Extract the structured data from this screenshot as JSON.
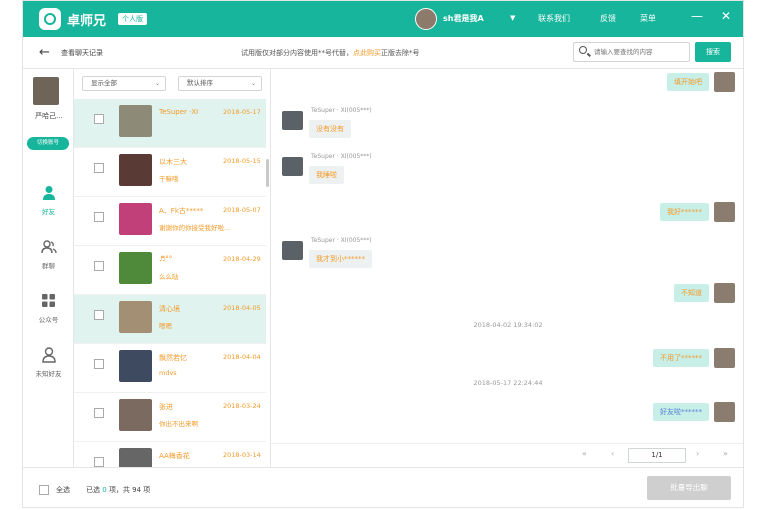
{
  "titlebar": {
    "app_name": "卓师兄",
    "edition": "个人版",
    "username": "sh君是我A",
    "links": [
      "联系我们",
      "反馈",
      "菜单"
    ],
    "minimize": "—",
    "close": "✕"
  },
  "toolbar": {
    "back_label": "查看聊天记录",
    "notice_text": "试用版仅对部分内容使用**号代替，",
    "notice_link": "点此购买",
    "notice_tail": "正版去除*号",
    "search_placeholder": "请输入要查找的内容",
    "search_button": "搜索"
  },
  "leftnav": {
    "account_name": "严哈己...",
    "switch_button": "切换账号",
    "items": [
      {
        "label": "好友",
        "icon": "person-icon"
      },
      {
        "label": "群聊",
        "icon": "group-icon"
      },
      {
        "label": "公众号",
        "icon": "grid-icon"
      },
      {
        "label": "未知好友",
        "icon": "unknown-user-icon"
      }
    ]
  },
  "contacts": {
    "filter_show": "显示全部",
    "filter_sort": "默认排序",
    "rows": [
      {
        "name": "TeSuper ·XI",
        "date": "2018-05-17",
        "msg": "",
        "avatar_color": "#8d8a78"
      },
      {
        "name": "以木三大",
        "date": "2018-05-15",
        "msg": "干嘛哦",
        "avatar_color": "#5a3a34"
      },
      {
        "name": "A、Fk古*****",
        "date": "2018-05-07",
        "msg": "谢谢你的你接受我好啦...",
        "avatar_color": "#c2407a"
      },
      {
        "name": "♬°°",
        "date": "2018-04-29",
        "msg": "么么哒",
        "avatar_color": "#4f8a3a"
      },
      {
        "name": "清心境",
        "date": "2018-04-05",
        "msg": "嗯嗯",
        "avatar_color": "#a38f74"
      },
      {
        "name": "飘然若忆",
        "date": "2018-04-04",
        "msg": "mdvs",
        "avatar_color": "#3d4a60"
      },
      {
        "name": "张进",
        "date": "2018-03-24",
        "msg": "你出不出来啊",
        "avatar_color": "#7a6a60"
      },
      {
        "name": "AA梅香花",
        "date": "2018-03-14",
        "msg": "",
        "avatar_color": "#666666"
      }
    ]
  },
  "chat": {
    "messages": [
      {
        "dir": "out",
        "text": "填开始吧",
        "blue": false
      },
      {
        "dir": "in",
        "sender": "TeSuper · XI(005***)",
        "text": "没有没有"
      },
      {
        "dir": "in",
        "sender": "TeSuper · XI(005***)",
        "text": "我睡啦"
      },
      {
        "dir": "out",
        "text": "我好******",
        "blue": false
      },
      {
        "dir": "in",
        "sender": "TeSuper · XI(005***)",
        "text": "我才到小******"
      },
      {
        "dir": "out",
        "text": "不知道",
        "blue": false
      },
      {
        "dir": "time",
        "text": "2018-04-02 19:34:02"
      },
      {
        "dir": "out",
        "text": "不用了******",
        "blue": false
      },
      {
        "dir": "time",
        "text": "2018-05-17 22:24:44"
      },
      {
        "dir": "out",
        "text": "好友啦******",
        "blue": true
      }
    ]
  },
  "pager": {
    "first": "«",
    "prev": "‹",
    "page": "1/1",
    "next": "›",
    "last": "»"
  },
  "footer": {
    "select_all": "全选",
    "selected_prefix": "已选",
    "selected_count": "0",
    "selected_suffix": "项，共 94 项",
    "export_button": "批量导出聊"
  },
  "colors": {
    "brand": "#16b59c",
    "highlight": "#f39a28",
    "selected_row": "#e0f3ef"
  }
}
